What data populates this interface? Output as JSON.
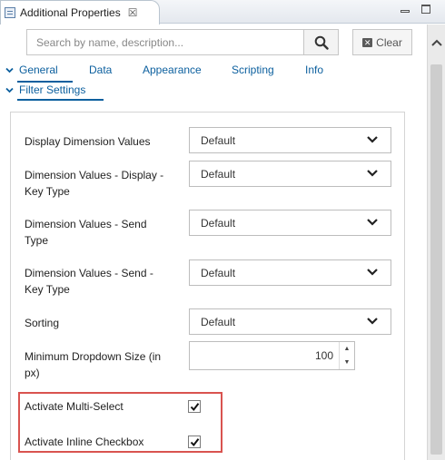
{
  "window": {
    "title": "Additional Properties",
    "close_glyph": "☒",
    "scroll_up_glyph": "⌃"
  },
  "search": {
    "placeholder": "Search by name, description...",
    "value": "",
    "clear_label": "Clear"
  },
  "tabs": [
    {
      "label": "General",
      "active": true
    },
    {
      "label": "Data",
      "active": false
    },
    {
      "label": "Appearance",
      "active": false
    },
    {
      "label": "Scripting",
      "active": false
    },
    {
      "label": "Info",
      "active": false
    }
  ],
  "section": {
    "title": "Filter Settings",
    "expanded": true
  },
  "properties": {
    "display_dimension_values": {
      "label": "Display Dimension Values",
      "value": "Default"
    },
    "dimension_values_display_key_type": {
      "label": "Dimension Values - Display - Key Type",
      "value": "Default"
    },
    "dimension_values_send_type": {
      "label": "Dimension Values - Send Type",
      "value": "Default"
    },
    "dimension_values_send_key_type": {
      "label": "Dimension Values - Send - Key Type",
      "value": "Default"
    },
    "sorting": {
      "label": "Sorting",
      "value": "Default"
    },
    "minimum_dropdown_size": {
      "label": "Minimum Dropdown Size (in px)",
      "value": "100"
    },
    "activate_multi_select": {
      "label": "Activate Multi-Select",
      "checked": true
    },
    "activate_inline_checkbox": {
      "label": "Activate Inline Checkbox",
      "checked": true
    }
  },
  "icons": {
    "view_icon": "properties-view-icon",
    "search": "search-icon",
    "clear": "clear-x-icon",
    "dropdown": "chevron-down-icon",
    "checkbox": "checkmark-icon"
  },
  "colors": {
    "accent": "#0b5f9e",
    "highlight_border": "#d9534f"
  }
}
